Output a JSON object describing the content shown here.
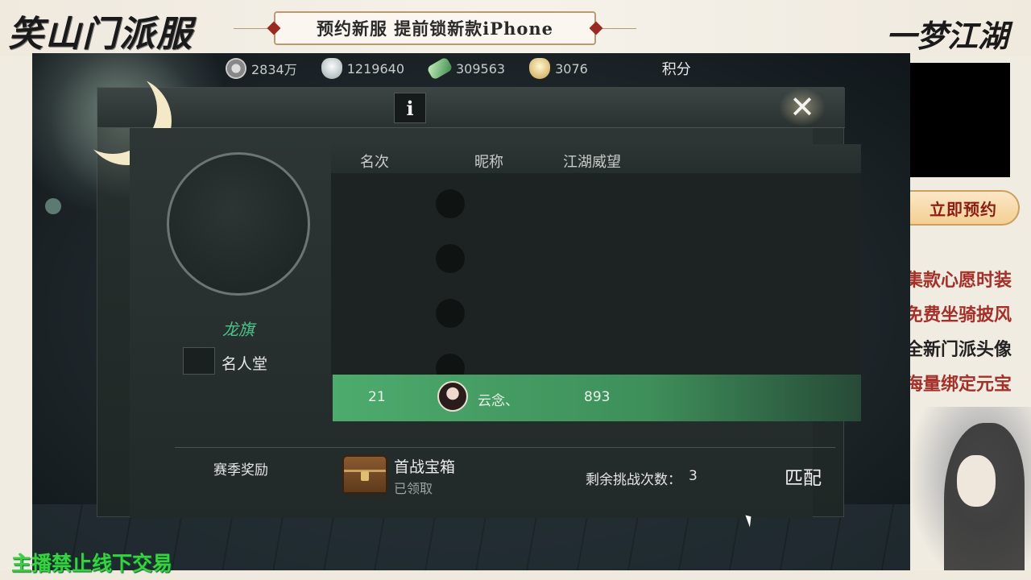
{
  "overlay": {
    "brand_left": "笑山门派服",
    "promo_text": "预约新服 提前锁新款iPhone",
    "brand_right": "一梦江湖",
    "reserve_button": "立即预约",
    "side_texts": [
      "集款心愿时装",
      "免费坐骑披风",
      "全新门派头像",
      "海量绑定元宝"
    ],
    "bottom_notice": "主播禁止线下交易"
  },
  "currency": [
    {
      "icon": "coin-icon",
      "value": "2834万"
    },
    {
      "icon": "silver-icon",
      "value": "1219640"
    },
    {
      "icon": "jade-icon",
      "value": "309563"
    },
    {
      "icon": "ingot-icon",
      "value": "3076"
    }
  ],
  "points_label": "积分",
  "modal": {
    "info_icon": "i",
    "close_icon": "✕",
    "profile_name": "龙旗",
    "hall_of_fame_label": "名人堂",
    "table_headers": {
      "rank": "名次",
      "name": "昵称",
      "fame": "江湖威望"
    },
    "my_row": {
      "rank": "21",
      "name": "云念、",
      "fame": "893"
    },
    "season_reward_label": "赛季奖励",
    "chest_title": "首战宝箱",
    "chest_status": "已领取",
    "attempts_label": "剩余挑战次数：",
    "attempts_count": "3",
    "match_button": "匹配"
  },
  "colors": {
    "accent_green": "#4dab6d",
    "notice_green": "#3ad040",
    "reserve_red": "#8b1d14"
  }
}
